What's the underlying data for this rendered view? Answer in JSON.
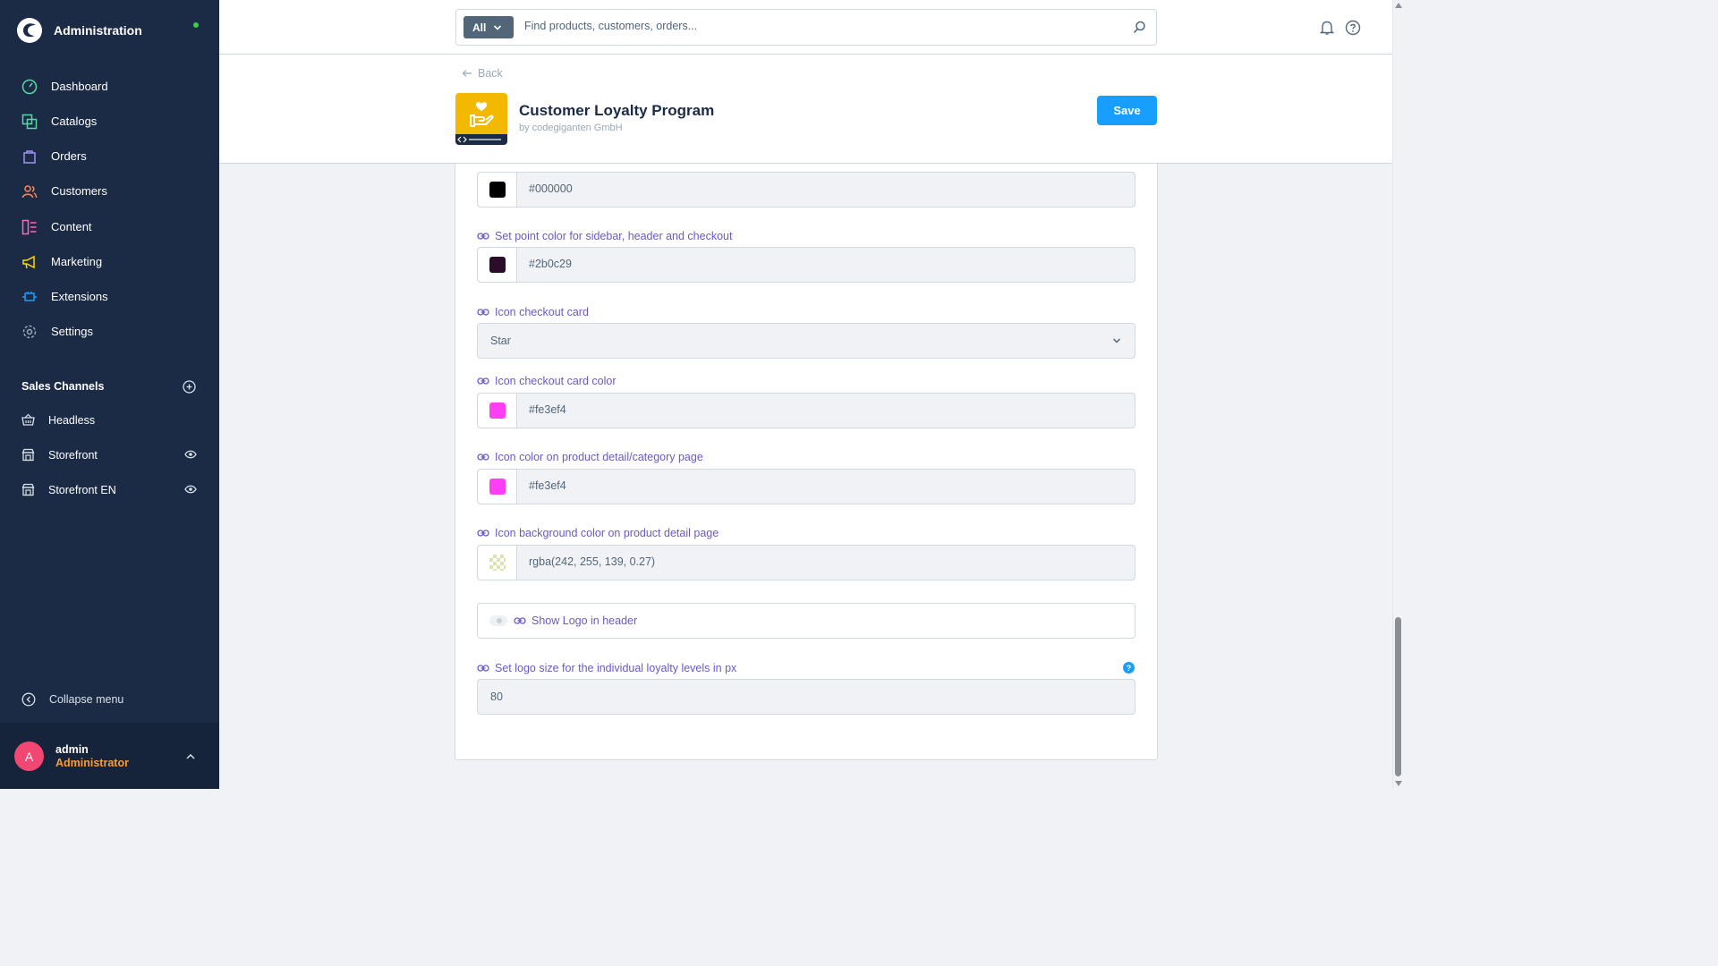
{
  "sidebar": {
    "title": "Administration",
    "nav": [
      {
        "label": "Dashboard",
        "icon": "dashboard-icon",
        "color": "#57d9a3"
      },
      {
        "label": "Catalogs",
        "icon": "catalogs-icon",
        "color": "#57d9a3"
      },
      {
        "label": "Orders",
        "icon": "orders-icon",
        "color": "#a092f0"
      },
      {
        "label": "Customers",
        "icon": "customers-icon",
        "color": "#f88962"
      },
      {
        "label": "Content",
        "icon": "content-icon",
        "color": "#ff68b4"
      },
      {
        "label": "Marketing",
        "icon": "marketing-icon",
        "color": "#ffd700"
      },
      {
        "label": "Extensions",
        "icon": "extensions-icon",
        "color": "#189eff"
      },
      {
        "label": "Settings",
        "icon": "settings-icon",
        "color": "#9aa8b5"
      }
    ],
    "sales_channels": {
      "title": "Sales Channels",
      "items": [
        {
          "label": "Headless",
          "icon": "basket-icon"
        },
        {
          "label": "Storefront",
          "icon": "storefront-icon"
        },
        {
          "label": "Storefront EN",
          "icon": "storefront-icon"
        }
      ]
    },
    "collapse_label": "Collapse menu",
    "user": {
      "initial": "A",
      "name": "admin",
      "role": "Administrator"
    }
  },
  "topbar": {
    "search_scope": "All",
    "search_placeholder": "Find products, customers, orders..."
  },
  "page": {
    "back_label": "Back",
    "plugin_title": "Customer Loyalty Program",
    "plugin_author": "by codegiganten GmbH",
    "save_label": "Save"
  },
  "form": {
    "fields": [
      {
        "value": "#000000",
        "swatch": "#000000"
      },
      {
        "label": "Set point color for sidebar, header and checkout",
        "value": "#2b0c29",
        "swatch": "#2b0c29"
      },
      {
        "label": "Icon checkout card",
        "value": "Star"
      },
      {
        "label": "Icon checkout card color",
        "value": "#fe3ef4",
        "swatch": "#fe3ef4"
      },
      {
        "label": "Icon color on product detail/category page",
        "value": "#fe3ef4",
        "swatch": "#fe3ef4"
      },
      {
        "label": "Icon background color on product detail page",
        "value": "rgba(242, 255, 139, 0.27)",
        "swatch": "rgba(242, 255, 139, 0.27)"
      },
      {
        "label": "Show Logo in header",
        "checked": false
      },
      {
        "label": "Set logo size for the individual loyalty levels in px",
        "value": "80"
      }
    ]
  }
}
